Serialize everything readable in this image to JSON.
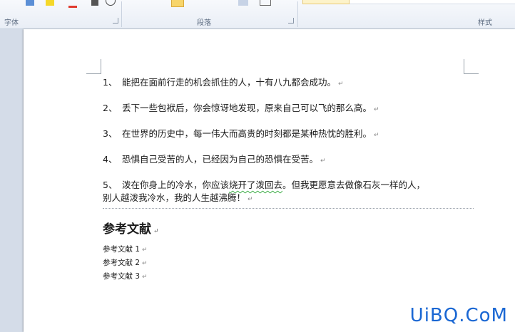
{
  "ribbon": {
    "groups": [
      {
        "label": "字体"
      },
      {
        "label": "段落"
      },
      {
        "label": "样式"
      }
    ]
  },
  "document": {
    "items": [
      {
        "number": "1、",
        "text": "能把在面前行走的机会抓住的人，十有八九都会成功。"
      },
      {
        "number": "2、",
        "text": "丢下一些包袱后，你会惊讶地发现，原来自己可以飞的那么高。"
      },
      {
        "number": "3、",
        "text": "在世界的历史中，每一伟大而高贵的时刻都是某种热忱的胜利。"
      },
      {
        "number": "4、",
        "text": "恐惧自己受苦的人，已经因为自己的恐惧在受苦。"
      },
      {
        "number": "5、",
        "text_before": "泼在你身上的冷水，你应该",
        "text_marked": "烧开了泼回去",
        "text_after": "。但我更愿意去做像石灰一样的人，",
        "line2": "别人越泼我冷水，我的人生越沸腾！"
      }
    ],
    "paragraph_mark": "↵",
    "references_title": "参考文献",
    "references": [
      "参考文献 1",
      "参考文献 2",
      "参考文献 3"
    ]
  },
  "watermark": "UiBQ.CoM"
}
